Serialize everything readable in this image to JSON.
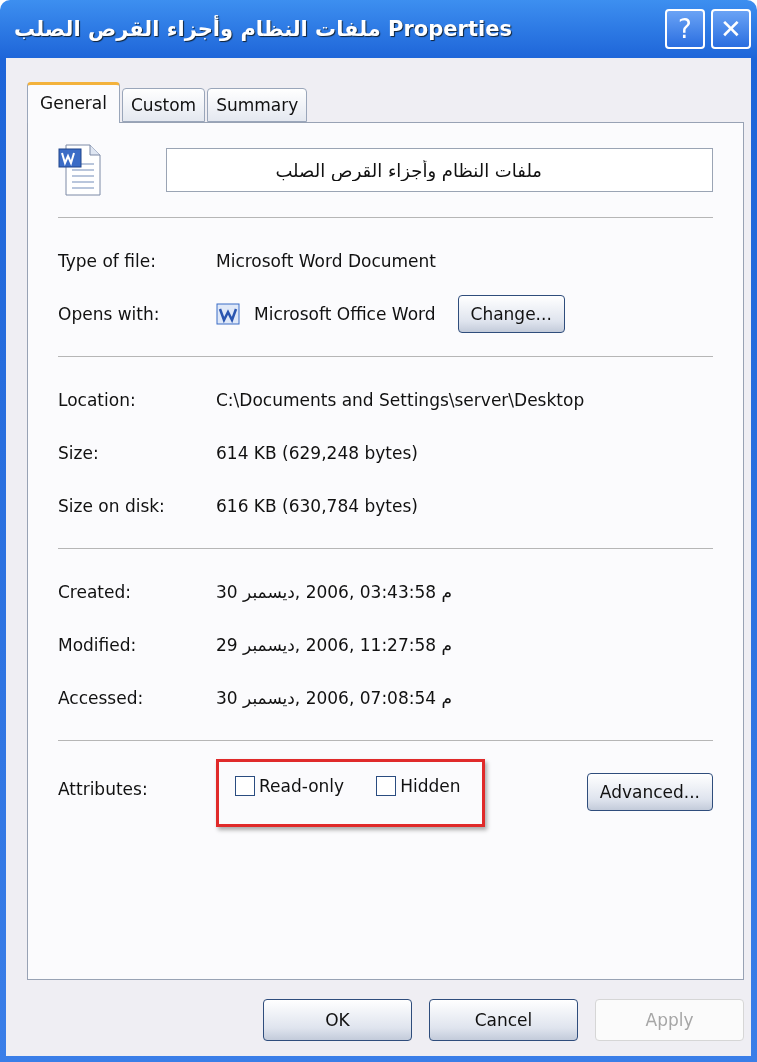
{
  "window": {
    "title": "ملفات النظام وأجزاء القرص الصلب Properties",
    "help_button": "?",
    "close_button": "✕"
  },
  "tabs": [
    {
      "label": "General",
      "selected": true
    },
    {
      "label": "Custom",
      "selected": false
    },
    {
      "label": "Summary",
      "selected": false
    }
  ],
  "file_name": {
    "value": "ملفات النظام وأجزاء القرص الصلب"
  },
  "sections": [
    [
      {
        "label": "Type of file:",
        "value": "Microsoft Word Document"
      },
      {
        "label": "Opens with:",
        "value": "Microsoft Office Word",
        "button": "Change..."
      }
    ],
    [
      {
        "label": "Location:",
        "value": "C:\\Documents and Settings\\server\\Desktop"
      },
      {
        "label": "Size:",
        "value": "614 KB (629,248 bytes)"
      },
      {
        "label": "Size on disk:",
        "value": "616 KB (630,784 bytes)"
      }
    ],
    [
      {
        "label": "Created:",
        "value": "30 ديسمبر, 2006, 03:43:58 م"
      },
      {
        "label": "Modified:",
        "value": "29 ديسمبر, 2006, 11:27:58 م"
      },
      {
        "label": "Accessed:",
        "value": "30 ديسمبر, 2006, 07:08:54 م"
      }
    ]
  ],
  "attributes": {
    "label": "Attributes:",
    "highlighted": true,
    "options": [
      {
        "label": "Read-only",
        "checked": false
      },
      {
        "label": "Hidden",
        "checked": false
      }
    ],
    "button": "Advanced..."
  },
  "buttons": [
    {
      "label": "OK",
      "disabled": false
    },
    {
      "label": "Cancel",
      "disabled": false
    },
    {
      "label": "Apply",
      "disabled": true
    }
  ]
}
